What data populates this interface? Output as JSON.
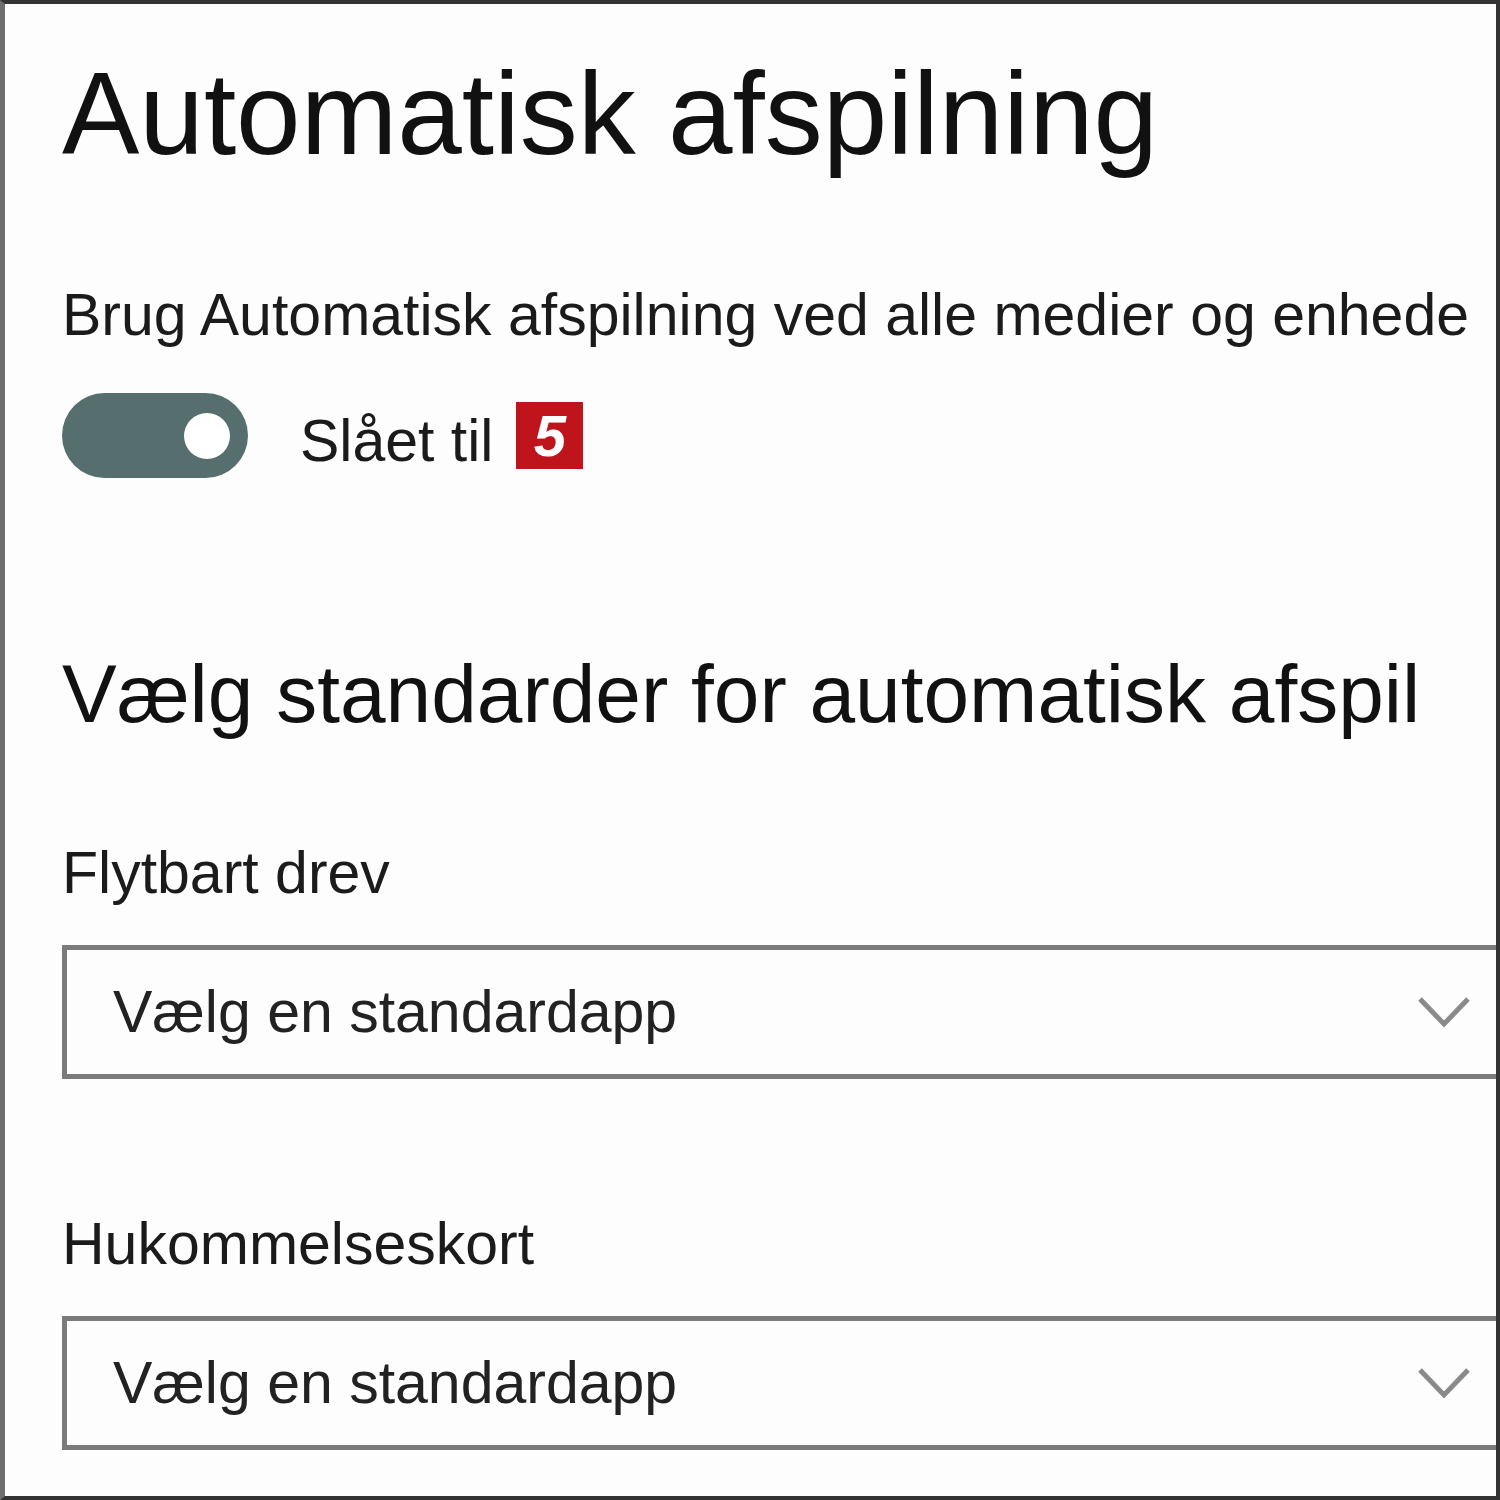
{
  "page": {
    "title": "Automatisk afspilning"
  },
  "autoplay": {
    "label": "Brug Automatisk afspilning ved alle medier og enhede",
    "toggle": {
      "on": true,
      "state_text": "Slået til"
    },
    "callout": "5"
  },
  "defaults": {
    "heading": "Vælg standarder for automatisk afspil",
    "dropdowns": [
      {
        "label": "Flytbart drev",
        "placeholder": "Vælg en standardapp"
      },
      {
        "label": "Hukommelseskort",
        "placeholder": "Vælg en standardapp"
      }
    ]
  }
}
